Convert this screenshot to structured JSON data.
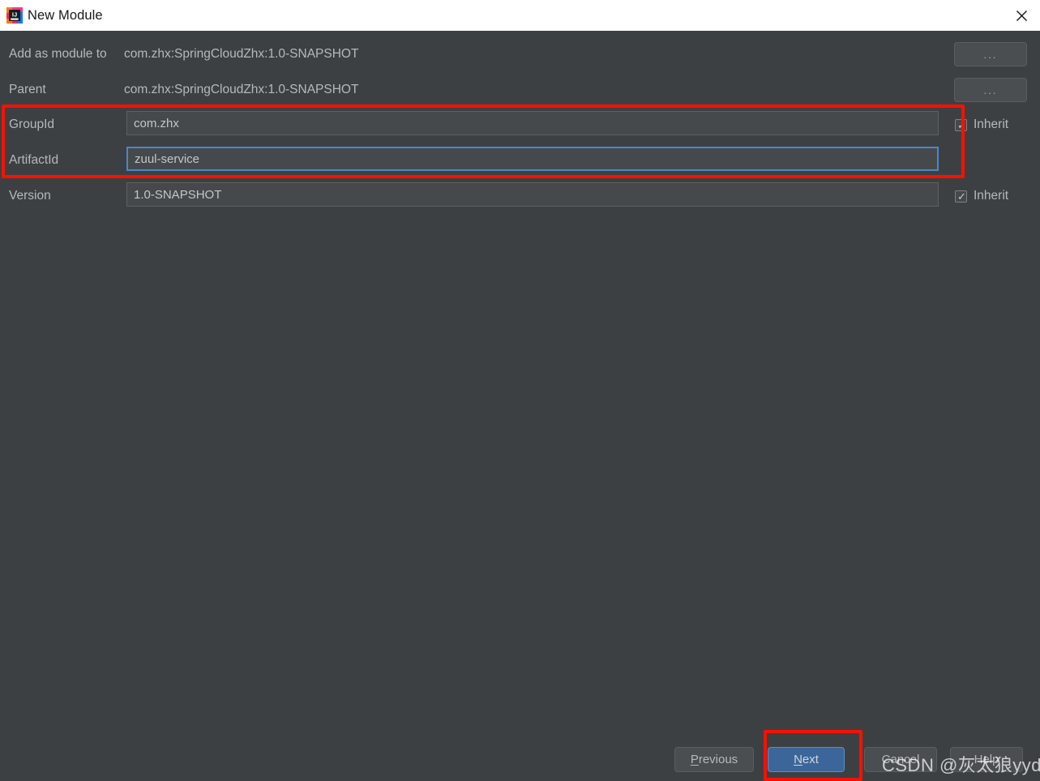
{
  "window": {
    "title": "New Module",
    "icon": "intellij-idea-icon",
    "close_icon": "close-icon"
  },
  "colors": {
    "background": "#3c4043",
    "titlebar": "#ffffff",
    "field_bg": "#45494c",
    "focus_border": "#4b88c4",
    "default_button": "#3c6699",
    "annotation": "#fd1000",
    "label_text": "#b6b9bb"
  },
  "form": {
    "rows": [
      {
        "label": "Add as module to",
        "value": "com.zhx:SpringCloudZhx:1.0-SNAPSHOT",
        "browse_label": "..."
      },
      {
        "label": "Parent",
        "value": "com.zhx:SpringCloudZhx:1.0-SNAPSHOT",
        "browse_label": "..."
      }
    ],
    "fields": [
      {
        "label": "GroupId",
        "value": "com.zhx",
        "inherit_label": "Inherit",
        "inherit_checked": true
      },
      {
        "label": "ArtifactId",
        "value": "zuul-service",
        "inherit_label": "",
        "inherit_checked": false
      },
      {
        "label": "Version",
        "value": "1.0-SNAPSHOT",
        "inherit_label": "Inherit",
        "inherit_checked": true
      }
    ]
  },
  "footer": {
    "previous_label": "Previous",
    "next_label": "Next",
    "cancel_label": "Cancel",
    "help_label": "Help"
  },
  "watermark": {
    "text": "CSDN @灰太狼yyds"
  }
}
